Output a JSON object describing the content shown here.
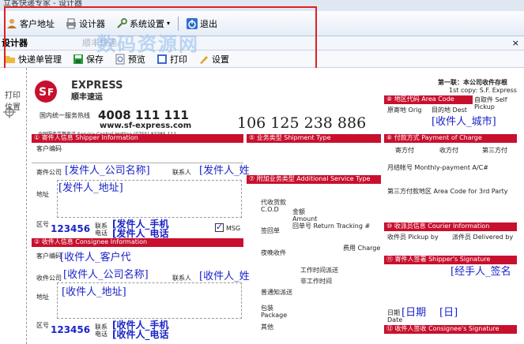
{
  "window": {
    "title": "立客快递专家 - 设计器"
  },
  "toolbar": {
    "items": [
      {
        "label": "客户地址",
        "icon": "user-icon"
      },
      {
        "label": "设计器",
        "icon": "printer-icon"
      },
      {
        "label": "系统设置",
        "icon": "settings-icon"
      },
      {
        "label": "退出",
        "icon": "power-icon"
      }
    ]
  },
  "panel": {
    "title": "设计器",
    "tab": "顺丰快递",
    "close": "×"
  },
  "toolbar2": {
    "items": [
      {
        "label": "快递单管理",
        "icon": "folder-icon"
      },
      {
        "label": "保存",
        "icon": "save-icon"
      },
      {
        "label": "预览",
        "icon": "preview-icon"
      },
      {
        "label": "打印",
        "icon": "print-icon"
      },
      {
        "label": "设置",
        "icon": "edit-icon"
      }
    ]
  },
  "watermark": "数码资源网",
  "side": {
    "print_label": "打印位置"
  },
  "waybill": {
    "brand": "EXPRESS",
    "brand_cn": "顺丰速运",
    "hotline_label": "国内统一服务热线",
    "hotline": "4008 111 111",
    "website": "www.sf-express.com",
    "hotline_sub": "全国服务监督电话 Service Control Hotline (0755) 83385 111",
    "tracking": "106 125 238 886",
    "copy": "第一联：本公司收件存根",
    "copy_en": "1st copy: S.F. Express",
    "sections": {
      "sender": "① 寄件人信息 Shipper Information",
      "service": "⑤ 业务类型 Shipment Type",
      "payment": "⑧ 付款方式 Payment of Charge",
      "area": "⑧ 地区代码 Area Code",
      "additional": "⑦ 附加业务类型 Additional Service Type",
      "consignee": "② 收件人信息 Consignee Information",
      "courier": "⑩ 收派员信息 Courier Information",
      "shipper_sig": "⑪ 寄件人签署 Shipper's Signature",
      "consignee_sig": "⑫ 收件人签收 Consignee's Signature"
    },
    "labels": {
      "customer_code": "客户编码",
      "sender_company": "寄件公司",
      "contact": "联系人",
      "address": "地址",
      "area_code": "区号",
      "tel": "联系电话",
      "recv_company": "收件公司",
      "orig": "原寄地 Orig",
      "dest": "目的地 Dest",
      "self_pickup": "自取件 Self Pickup",
      "pay_shipper": "寄方付",
      "pay_consignee": "收方付",
      "pay_third": "第三方付",
      "monthly": "月结帐号 Monthly-payment A/C#",
      "third_area": "第三方付款地区 Area Code for 3rd Party",
      "cod": "代收货款 C.O.D",
      "amount": "金额 Amount",
      "return": "签回单",
      "return_no": "回单号 Return Tracking #",
      "evening": "夜晚收件",
      "weekday": "工作时间派送",
      "holiday": "非工作时间",
      "normal": "普通知派送",
      "package": "包装 Package",
      "other": "其他",
      "charge": "费用 Charge",
      "pickup_by": "收件员 Pickup by",
      "delivered_by": "派件员 Delivered by",
      "date": "日期 Date",
      "msg": "MSG"
    },
    "fields": {
      "recv_city": "[收件人_城市]",
      "sender_company": "[发件人_公司名称]",
      "sender_contact": "[发件人_姓",
      "sender_address": "[发件人_地址]",
      "sender_area": "123456",
      "sender_mobile": "[发件人_手机",
      "sender_phone": "[发件人_电话",
      "recv_customer": "[收件人_客户代",
      "recv_company": "[收件人_公司名称]",
      "recv_contact": "[收件人_姓",
      "recv_address": "[收件人_地址]",
      "recv_area": "123456",
      "recv_mobile": "[收件人_手机",
      "recv_phone": "[收件人_电话",
      "handler_sig": "[经手人_签名",
      "date_day": "[日期",
      "date_day2": "[日]"
    }
  }
}
